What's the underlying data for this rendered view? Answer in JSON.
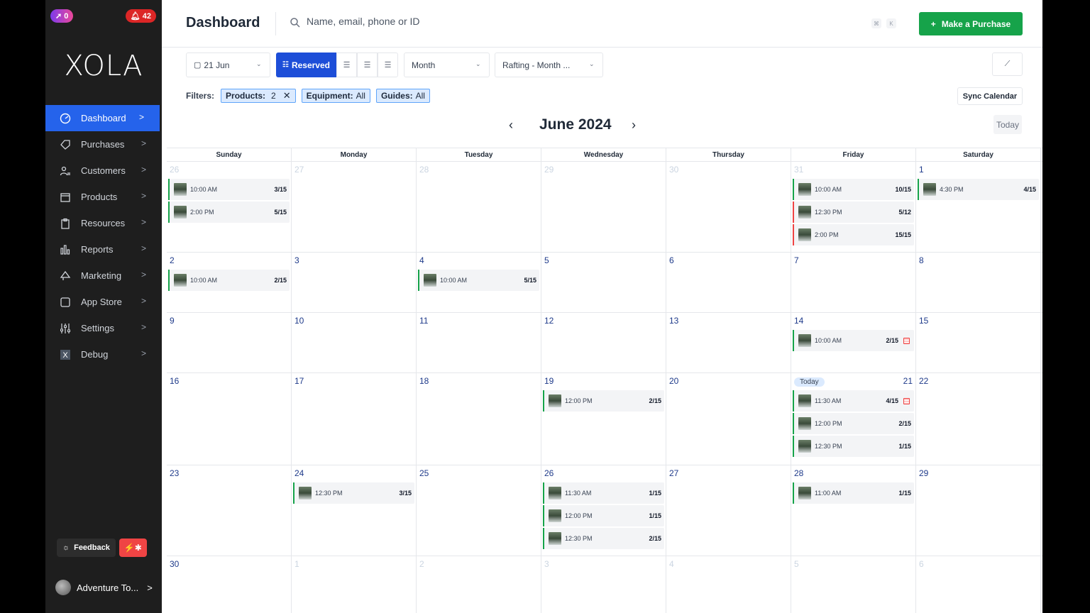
{
  "sidebar": {
    "notif_left": "0",
    "notif_right": "42",
    "logo": "XOLA",
    "items": [
      {
        "label": "Dashboard",
        "icon": "dashboard-icon",
        "active": true
      },
      {
        "label": "Purchases",
        "icon": "tag-icon"
      },
      {
        "label": "Customers",
        "icon": "users-icon"
      },
      {
        "label": "Products",
        "icon": "box-icon"
      },
      {
        "label": "Resources",
        "icon": "clipboard-icon"
      },
      {
        "label": "Reports",
        "icon": "bar-chart-icon"
      },
      {
        "label": "Marketing",
        "icon": "megaphone-icon"
      },
      {
        "label": "App Store",
        "icon": "square-icon"
      },
      {
        "label": "Settings",
        "icon": "sliders-icon"
      },
      {
        "label": "Debug",
        "icon": "x-box-icon"
      }
    ],
    "feedback_label": "Feedback",
    "user_name": "Adventure To..."
  },
  "header": {
    "title": "Dashboard",
    "search_placeholder": "Name, email, phone or ID",
    "kbd1": "⌘",
    "kbd2": "K",
    "purchase_label": "Make a Purchase"
  },
  "toolbar": {
    "date": "21 Jun",
    "reserved_label": "Reserved",
    "view_select": "Month",
    "product_select": "Rafting - Month ..."
  },
  "filters": {
    "label": "Filters:",
    "chips": [
      {
        "key": "Products:",
        "value": "2"
      },
      {
        "key": "Equipment:",
        "value": "All"
      },
      {
        "key": "Guides:",
        "value": "All"
      }
    ],
    "sync_label": "Sync Calendar"
  },
  "calendar": {
    "month_title": "June 2024",
    "today_label": "Today",
    "today_pill": "Today",
    "days_of_week": [
      "Sunday",
      "Monday",
      "Tuesday",
      "Wednesday",
      "Thursday",
      "Friday",
      "Saturday"
    ],
    "weeks": [
      {
        "cells": [
          {
            "day": "26",
            "muted": true,
            "events": [
              {
                "time": "10:00 AM",
                "count": "3/15"
              },
              {
                "time": "2:00 PM",
                "count": "5/15"
              }
            ]
          },
          {
            "day": "27",
            "muted": true,
            "events": []
          },
          {
            "day": "28",
            "muted": true,
            "events": []
          },
          {
            "day": "29",
            "muted": true,
            "events": []
          },
          {
            "day": "30",
            "muted": true,
            "events": []
          },
          {
            "day": "31",
            "muted": true,
            "events": [
              {
                "time": "10:00 AM",
                "count": "10/15"
              },
              {
                "time": "12:30 PM",
                "count": "5/12",
                "red": true
              },
              {
                "time": "2:00 PM",
                "count": "15/15",
                "red": true
              }
            ]
          },
          {
            "day": "1",
            "events": [
              {
                "time": "4:30 PM",
                "count": "4/15"
              }
            ]
          }
        ]
      },
      {
        "cells": [
          {
            "day": "2",
            "events": [
              {
                "time": "10:00 AM",
                "count": "2/15"
              }
            ]
          },
          {
            "day": "3",
            "events": []
          },
          {
            "day": "4",
            "events": [
              {
                "time": "10:00 AM",
                "count": "5/15"
              }
            ]
          },
          {
            "day": "5",
            "events": []
          },
          {
            "day": "6",
            "events": []
          },
          {
            "day": "7",
            "events": []
          },
          {
            "day": "8",
            "events": []
          }
        ]
      },
      {
        "cells": [
          {
            "day": "9",
            "events": []
          },
          {
            "day": "10",
            "events": []
          },
          {
            "day": "11",
            "events": []
          },
          {
            "day": "12",
            "events": []
          },
          {
            "day": "13",
            "events": []
          },
          {
            "day": "14",
            "events": [
              {
                "time": "10:00 AM",
                "count": "2/15",
                "warn": true
              }
            ]
          },
          {
            "day": "15",
            "events": []
          }
        ]
      },
      {
        "cells": [
          {
            "day": "16",
            "events": []
          },
          {
            "day": "17",
            "events": []
          },
          {
            "day": "18",
            "events": []
          },
          {
            "day": "19",
            "events": [
              {
                "time": "12:00 PM",
                "count": "2/15"
              }
            ]
          },
          {
            "day": "20",
            "events": []
          },
          {
            "day": "21",
            "today": true,
            "events": [
              {
                "time": "11:30 AM",
                "count": "4/15",
                "warn": true
              },
              {
                "time": "12:00 PM",
                "count": "2/15"
              },
              {
                "time": "12:30 PM",
                "count": "1/15"
              }
            ]
          },
          {
            "day": "22",
            "events": []
          }
        ]
      },
      {
        "cells": [
          {
            "day": "23",
            "events": []
          },
          {
            "day": "24",
            "events": [
              {
                "time": "12:30 PM",
                "count": "3/15"
              }
            ]
          },
          {
            "day": "25",
            "events": []
          },
          {
            "day": "26",
            "events": [
              {
                "time": "11:30 AM",
                "count": "1/15"
              },
              {
                "time": "12:00 PM",
                "count": "1/15"
              },
              {
                "time": "12:30 PM",
                "count": "2/15"
              }
            ]
          },
          {
            "day": "27",
            "events": []
          },
          {
            "day": "28",
            "events": [
              {
                "time": "11:00 AM",
                "count": "1/15"
              }
            ]
          },
          {
            "day": "29",
            "events": []
          }
        ]
      },
      {
        "cells": [
          {
            "day": "30",
            "events": []
          },
          {
            "day": "1",
            "muted": true,
            "events": []
          },
          {
            "day": "2",
            "muted": true,
            "events": []
          },
          {
            "day": "3",
            "muted": true,
            "events": []
          },
          {
            "day": "4",
            "muted": true,
            "events": []
          },
          {
            "day": "5",
            "muted": true,
            "events": []
          },
          {
            "day": "6",
            "muted": true,
            "events": []
          }
        ]
      }
    ]
  }
}
